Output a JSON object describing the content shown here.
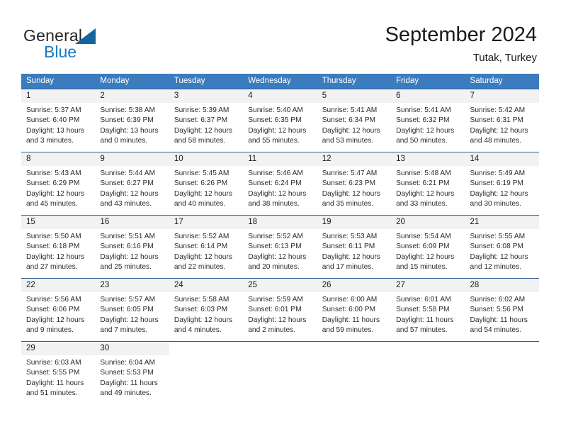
{
  "brand": {
    "name_part1": "General",
    "name_part2": "Blue",
    "triangle_color": "#1464a0",
    "blue_color": "#1779c4"
  },
  "header": {
    "title": "September 2024",
    "subtitle": "Tutak, Turkey"
  },
  "theme": {
    "header_row_bg": "#3b7cbf",
    "divider": "#2e5f8f",
    "daynum_bg": "#f2f2f2",
    "text": "#1a1a1a"
  },
  "weekdays": [
    "Sunday",
    "Monday",
    "Tuesday",
    "Wednesday",
    "Thursday",
    "Friday",
    "Saturday"
  ],
  "labels": {
    "sunrise": "Sunrise:",
    "sunset": "Sunset:",
    "daylight": "Daylight:"
  },
  "weeks": [
    [
      {
        "day": "1",
        "sunrise": "Sunrise: 5:37 AM",
        "sunset": "Sunset: 6:40 PM",
        "daylight1": "Daylight: 13 hours",
        "daylight2": "and 3 minutes."
      },
      {
        "day": "2",
        "sunrise": "Sunrise: 5:38 AM",
        "sunset": "Sunset: 6:39 PM",
        "daylight1": "Daylight: 13 hours",
        "daylight2": "and 0 minutes."
      },
      {
        "day": "3",
        "sunrise": "Sunrise: 5:39 AM",
        "sunset": "Sunset: 6:37 PM",
        "daylight1": "Daylight: 12 hours",
        "daylight2": "and 58 minutes."
      },
      {
        "day": "4",
        "sunrise": "Sunrise: 5:40 AM",
        "sunset": "Sunset: 6:35 PM",
        "daylight1": "Daylight: 12 hours",
        "daylight2": "and 55 minutes."
      },
      {
        "day": "5",
        "sunrise": "Sunrise: 5:41 AM",
        "sunset": "Sunset: 6:34 PM",
        "daylight1": "Daylight: 12 hours",
        "daylight2": "and 53 minutes."
      },
      {
        "day": "6",
        "sunrise": "Sunrise: 5:41 AM",
        "sunset": "Sunset: 6:32 PM",
        "daylight1": "Daylight: 12 hours",
        "daylight2": "and 50 minutes."
      },
      {
        "day": "7",
        "sunrise": "Sunrise: 5:42 AM",
        "sunset": "Sunset: 6:31 PM",
        "daylight1": "Daylight: 12 hours",
        "daylight2": "and 48 minutes."
      }
    ],
    [
      {
        "day": "8",
        "sunrise": "Sunrise: 5:43 AM",
        "sunset": "Sunset: 6:29 PM",
        "daylight1": "Daylight: 12 hours",
        "daylight2": "and 45 minutes."
      },
      {
        "day": "9",
        "sunrise": "Sunrise: 5:44 AM",
        "sunset": "Sunset: 6:27 PM",
        "daylight1": "Daylight: 12 hours",
        "daylight2": "and 43 minutes."
      },
      {
        "day": "10",
        "sunrise": "Sunrise: 5:45 AM",
        "sunset": "Sunset: 6:26 PM",
        "daylight1": "Daylight: 12 hours",
        "daylight2": "and 40 minutes."
      },
      {
        "day": "11",
        "sunrise": "Sunrise: 5:46 AM",
        "sunset": "Sunset: 6:24 PM",
        "daylight1": "Daylight: 12 hours",
        "daylight2": "and 38 minutes."
      },
      {
        "day": "12",
        "sunrise": "Sunrise: 5:47 AM",
        "sunset": "Sunset: 6:23 PM",
        "daylight1": "Daylight: 12 hours",
        "daylight2": "and 35 minutes."
      },
      {
        "day": "13",
        "sunrise": "Sunrise: 5:48 AM",
        "sunset": "Sunset: 6:21 PM",
        "daylight1": "Daylight: 12 hours",
        "daylight2": "and 33 minutes."
      },
      {
        "day": "14",
        "sunrise": "Sunrise: 5:49 AM",
        "sunset": "Sunset: 6:19 PM",
        "daylight1": "Daylight: 12 hours",
        "daylight2": "and 30 minutes."
      }
    ],
    [
      {
        "day": "15",
        "sunrise": "Sunrise: 5:50 AM",
        "sunset": "Sunset: 6:18 PM",
        "daylight1": "Daylight: 12 hours",
        "daylight2": "and 27 minutes."
      },
      {
        "day": "16",
        "sunrise": "Sunrise: 5:51 AM",
        "sunset": "Sunset: 6:16 PM",
        "daylight1": "Daylight: 12 hours",
        "daylight2": "and 25 minutes."
      },
      {
        "day": "17",
        "sunrise": "Sunrise: 5:52 AM",
        "sunset": "Sunset: 6:14 PM",
        "daylight1": "Daylight: 12 hours",
        "daylight2": "and 22 minutes."
      },
      {
        "day": "18",
        "sunrise": "Sunrise: 5:52 AM",
        "sunset": "Sunset: 6:13 PM",
        "daylight1": "Daylight: 12 hours",
        "daylight2": "and 20 minutes."
      },
      {
        "day": "19",
        "sunrise": "Sunrise: 5:53 AM",
        "sunset": "Sunset: 6:11 PM",
        "daylight1": "Daylight: 12 hours",
        "daylight2": "and 17 minutes."
      },
      {
        "day": "20",
        "sunrise": "Sunrise: 5:54 AM",
        "sunset": "Sunset: 6:09 PM",
        "daylight1": "Daylight: 12 hours",
        "daylight2": "and 15 minutes."
      },
      {
        "day": "21",
        "sunrise": "Sunrise: 5:55 AM",
        "sunset": "Sunset: 6:08 PM",
        "daylight1": "Daylight: 12 hours",
        "daylight2": "and 12 minutes."
      }
    ],
    [
      {
        "day": "22",
        "sunrise": "Sunrise: 5:56 AM",
        "sunset": "Sunset: 6:06 PM",
        "daylight1": "Daylight: 12 hours",
        "daylight2": "and 9 minutes."
      },
      {
        "day": "23",
        "sunrise": "Sunrise: 5:57 AM",
        "sunset": "Sunset: 6:05 PM",
        "daylight1": "Daylight: 12 hours",
        "daylight2": "and 7 minutes."
      },
      {
        "day": "24",
        "sunrise": "Sunrise: 5:58 AM",
        "sunset": "Sunset: 6:03 PM",
        "daylight1": "Daylight: 12 hours",
        "daylight2": "and 4 minutes."
      },
      {
        "day": "25",
        "sunrise": "Sunrise: 5:59 AM",
        "sunset": "Sunset: 6:01 PM",
        "daylight1": "Daylight: 12 hours",
        "daylight2": "and 2 minutes."
      },
      {
        "day": "26",
        "sunrise": "Sunrise: 6:00 AM",
        "sunset": "Sunset: 6:00 PM",
        "daylight1": "Daylight: 11 hours",
        "daylight2": "and 59 minutes."
      },
      {
        "day": "27",
        "sunrise": "Sunrise: 6:01 AM",
        "sunset": "Sunset: 5:58 PM",
        "daylight1": "Daylight: 11 hours",
        "daylight2": "and 57 minutes."
      },
      {
        "day": "28",
        "sunrise": "Sunrise: 6:02 AM",
        "sunset": "Sunset: 5:56 PM",
        "daylight1": "Daylight: 11 hours",
        "daylight2": "and 54 minutes."
      }
    ],
    [
      {
        "day": "29",
        "sunrise": "Sunrise: 6:03 AM",
        "sunset": "Sunset: 5:55 PM",
        "daylight1": "Daylight: 11 hours",
        "daylight2": "and 51 minutes."
      },
      {
        "day": "30",
        "sunrise": "Sunrise: 6:04 AM",
        "sunset": "Sunset: 5:53 PM",
        "daylight1": "Daylight: 11 hours",
        "daylight2": "and 49 minutes."
      },
      {
        "day": "",
        "sunrise": "",
        "sunset": "",
        "daylight1": "",
        "daylight2": ""
      },
      {
        "day": "",
        "sunrise": "",
        "sunset": "",
        "daylight1": "",
        "daylight2": ""
      },
      {
        "day": "",
        "sunrise": "",
        "sunset": "",
        "daylight1": "",
        "daylight2": ""
      },
      {
        "day": "",
        "sunrise": "",
        "sunset": "",
        "daylight1": "",
        "daylight2": ""
      },
      {
        "day": "",
        "sunrise": "",
        "sunset": "",
        "daylight1": "",
        "daylight2": ""
      }
    ]
  ]
}
